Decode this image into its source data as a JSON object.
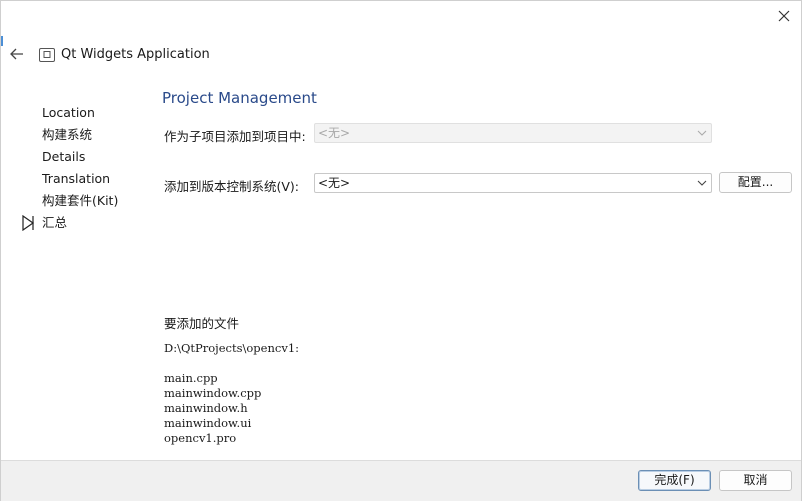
{
  "window": {
    "title": "Qt Widgets Application"
  },
  "sidebar": {
    "items": [
      {
        "label": "Location"
      },
      {
        "label": "构建系统"
      },
      {
        "label": "Details"
      },
      {
        "label": "Translation"
      },
      {
        "label": "构建套件(Kit)"
      },
      {
        "label": "汇总"
      }
    ],
    "current_index": 5
  },
  "page": {
    "title": "Project Management",
    "subproject_label": "作为子项目添加到项目中:",
    "subproject_value": "<无>",
    "vcs_label": "添加到版本控制系统(V):",
    "vcs_value": "<无>",
    "configure_label": "配置...",
    "files_heading": "要添加的文件",
    "files_dir": "D:\\QtProjects\\opencv1:",
    "files": [
      "main.cpp",
      "mainwindow.cpp",
      "mainwindow.h",
      "mainwindow.ui",
      "opencv1.pro"
    ]
  },
  "footer": {
    "finish_label": "完成(F)",
    "cancel_label": "取消"
  },
  "icons": {
    "close": "close-icon",
    "back": "arrow-left-icon",
    "app": "app-window-icon",
    "marker": "triangle-right-icon",
    "dropdown": "chevron-down-icon"
  },
  "colors": {
    "accent_title": "#2a4a8a",
    "primary_border": "#6b8fb5"
  }
}
